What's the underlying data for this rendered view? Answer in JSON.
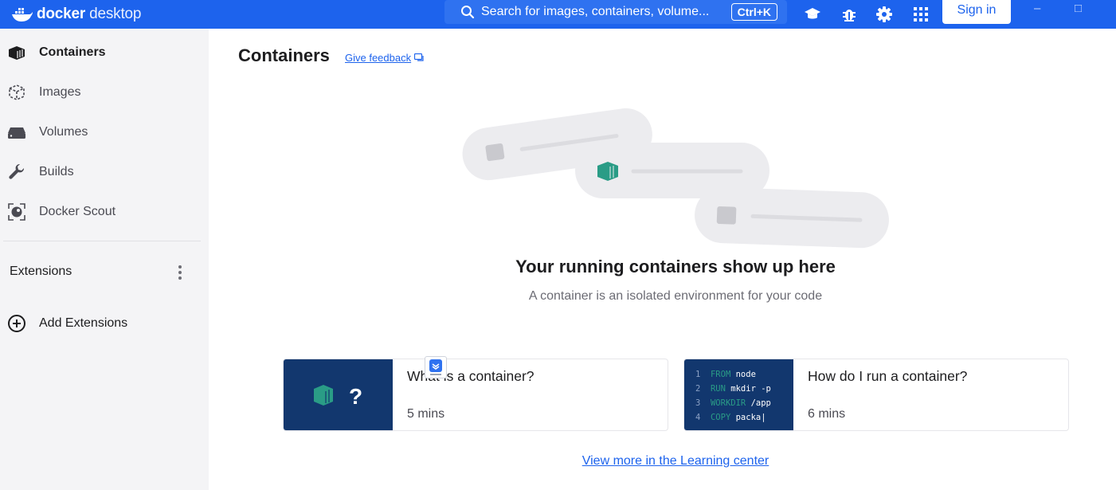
{
  "titlebar": {
    "logo_word1": "docker",
    "logo_word2": "desktop",
    "search_text": "Search for images, containers, volume...",
    "search_shortcut": "Ctrl+K",
    "sign_in_label": "Sign in",
    "minimize_glyph": "–",
    "maximize_glyph": "□",
    "icons": [
      "learn-icon",
      "bug-icon",
      "gear-icon",
      "apps-grid-icon"
    ],
    "accent_color": "#1d63ed"
  },
  "sidebar": {
    "items": [
      {
        "label": "Containers",
        "icon": "container-icon",
        "active": true
      },
      {
        "label": "Images",
        "icon": "image-cube-icon",
        "active": false
      },
      {
        "label": "Volumes",
        "icon": "volume-icon",
        "active": false
      },
      {
        "label": "Builds",
        "icon": "wrench-icon",
        "active": false
      },
      {
        "label": "Docker Scout",
        "icon": "scout-icon",
        "active": false
      }
    ],
    "extensions_header": "Extensions",
    "add_extensions_label": "Add Extensions"
  },
  "main": {
    "title": "Containers",
    "feedback_label": "Give feedback",
    "empty_title": "Your running containers show up here",
    "empty_subtitle": "A container is an isolated environment for your code",
    "cards": [
      {
        "title": "What is a container?",
        "duration": "5 mins"
      },
      {
        "title": "How do I run a container?",
        "duration": "6 mins",
        "code": [
          {
            "n": "1",
            "kw": "FROM",
            "rest": "node"
          },
          {
            "n": "2",
            "kw": "RUN",
            "rest": "mkdir -p"
          },
          {
            "n": "3",
            "kw": "WORKDIR",
            "rest": "/app"
          },
          {
            "n": "4",
            "kw": "COPY",
            "rest": "packa"
          }
        ]
      }
    ],
    "learn_link": "View more in the Learning center"
  }
}
